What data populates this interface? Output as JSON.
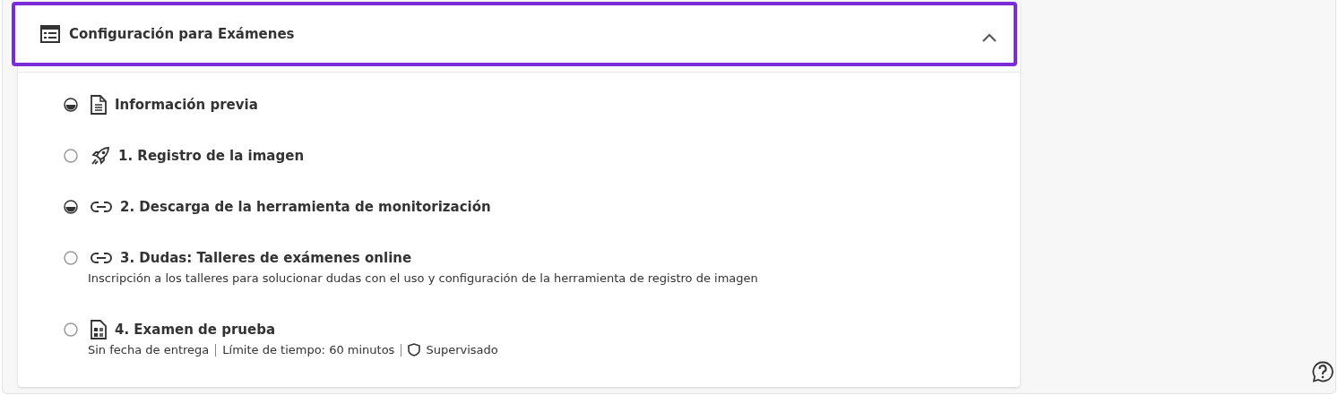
{
  "section": {
    "title": "Configuración para Exámenes",
    "expanded": true,
    "focused": true
  },
  "items": [
    {
      "title": "Información previa",
      "started": true,
      "kind": "document"
    },
    {
      "title": "1. Registro de la imagen",
      "started": false,
      "kind": "rocket"
    },
    {
      "title": "2. Descarga de la herramienta de monitorización",
      "started": true,
      "kind": "link"
    },
    {
      "title": "3. Dudas: Talleres de exámenes online",
      "started": false,
      "kind": "link",
      "description": "Inscripción a los talleres para solucionar dudas con el uso y configuración de la herramienta de registro de imagen"
    },
    {
      "title": "4. Examen de prueba",
      "started": false,
      "kind": "test",
      "details": [
        {
          "text": "Sin fecha de entrega",
          "kind": "text"
        },
        {
          "text": "Límite de tiempo: 60 minutos",
          "kind": "text"
        },
        {
          "text": "Supervisado",
          "kind": "proctored"
        }
      ]
    }
  ]
}
